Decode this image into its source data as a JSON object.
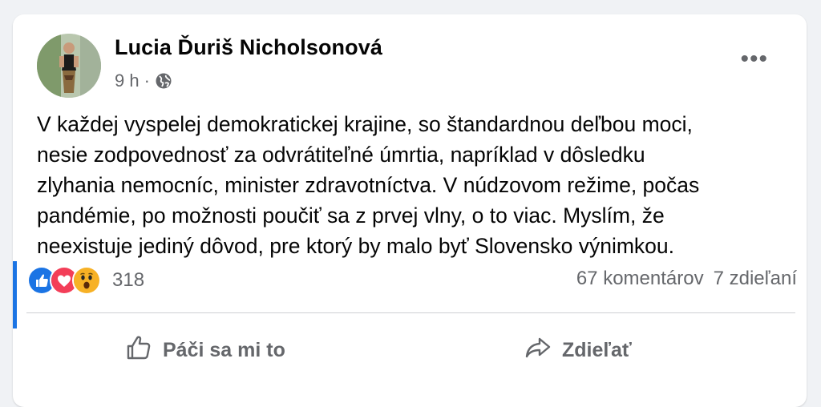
{
  "post": {
    "author": "Lucia Ďuriš Nicholsonová",
    "time": "9 h",
    "separator": "·",
    "more_label": "•••",
    "text_lines": [
      "V každej vyspelej demokratickej krajine, so štandardnou deľbou moci,",
      "nesie zodpovednosť za odvrátiteľné úmrtia, napríklad v dôsledku",
      "zlyhania nemocníc, minister zdravotníctva. V núdzovom režime, počas",
      "pandémie, po možnosti poučiť sa z prvej vlny, o to viac. Myslím, že",
      "neexistuje jediný dôvod, pre ktorý by malo byť Slovensko výnimkou."
    ],
    "reactions": {
      "count": "318",
      "types": [
        "like-reaction-icon",
        "love-reaction-icon",
        "wow-reaction-icon"
      ]
    },
    "comments": "67 komentárov",
    "shares": "7 zdieľaní",
    "actions": {
      "like": "Páči sa mi to",
      "share": "Zdieľať"
    }
  },
  "colors": {
    "like_blue": "#1b74e4",
    "love_red": "#f33e58",
    "wow_yellow": "#f7b125",
    "secondary_text": "#65676b"
  }
}
